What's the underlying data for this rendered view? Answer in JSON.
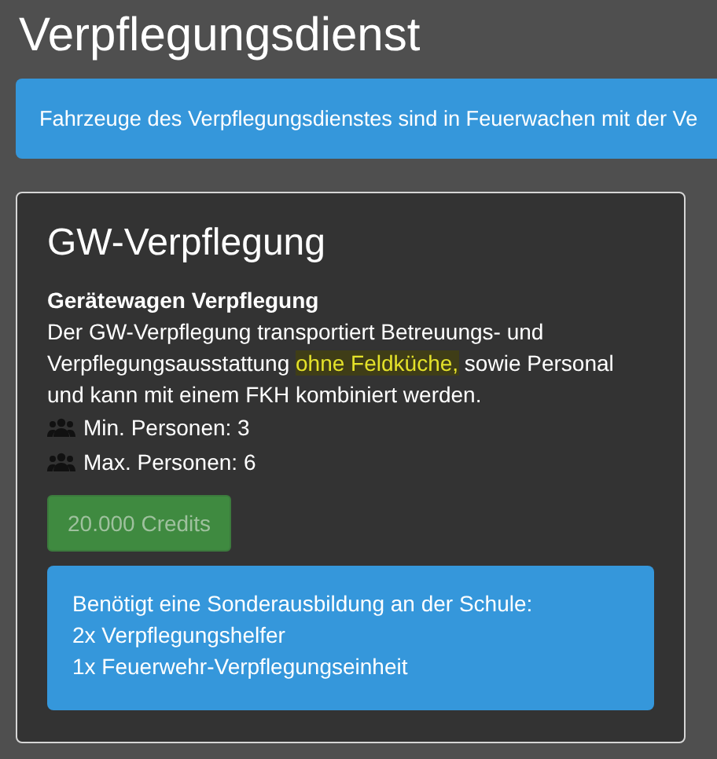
{
  "page_title": "Verpflegungsdienst",
  "info_banner": "Fahrzeuge des Verpflegungsdienstes sind in Feuerwachen mit der Ve",
  "vehicle": {
    "title": "GW-Verpflegung",
    "subtitle": "Gerätewagen Verpflegung",
    "description": [
      {
        "text": "Der GW-Verpflegung transportiert Betreuungs- und Verpflegungsausstattung ",
        "highlighted": false
      },
      {
        "text": "ohne Feldküche,",
        "highlighted": true
      },
      {
        "text": " sowie Personal und kann mit einem FKH kombiniert werden.",
        "highlighted": false
      }
    ],
    "stats": [
      "Min. Personen: 3",
      "Max. Personen: 6"
    ],
    "price_button": {
      "label": "20.000 Credits",
      "disabled": true
    },
    "training_notice": [
      "Benötigt eine Sonderausbildung an der Schule:",
      "2x Verpflegungshelfer",
      "1x Feuerwehr-Verpflegungseinheit"
    ]
  }
}
